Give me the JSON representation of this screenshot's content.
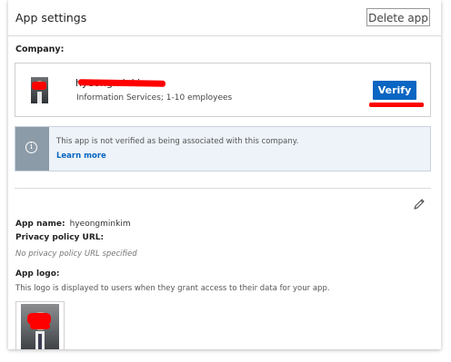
{
  "header": {
    "title": "App settings",
    "delete_label": "Delete app"
  },
  "company": {
    "section_label": "Company:",
    "name": "hyeongminkim",
    "meta": "Information Services; 1-10 employees",
    "verify_label": "Verify"
  },
  "notice": {
    "text": "This app is not verified as being associated with this company.",
    "link_label": "Learn more",
    "icon": "info-icon"
  },
  "details": {
    "edit_icon": "pencil-icon",
    "app_name_label": "App name:",
    "app_name_value": "hyeongminkim",
    "privacy_label": "Privacy policy URL:",
    "privacy_value": "No privacy policy URL specified",
    "logo_label": "App logo:",
    "logo_description": "This logo is displayed to users when they grant access to their data for your app."
  },
  "colors": {
    "accent": "#0a66c2",
    "redaction": "#ff0000",
    "notice_bg": "#edf3f8",
    "notice_side": "#8c9ba8"
  }
}
